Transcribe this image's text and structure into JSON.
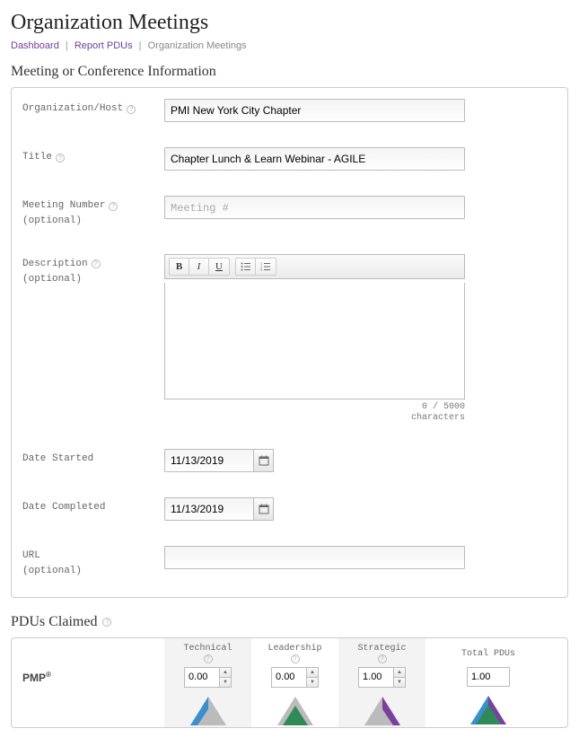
{
  "page_title": "Organization Meetings",
  "breadcrumb": {
    "dashboard": "Dashboard",
    "report_pdus": "Report PDUs",
    "current": "Organization Meetings"
  },
  "section1_title": "Meeting or Conference Information",
  "labels": {
    "org_host": "Organization/Host",
    "title": "Title",
    "meeting_number": "Meeting Number",
    "description": "Description",
    "date_started": "Date Started",
    "date_completed": "Date Completed",
    "url": "URL",
    "optional": "(optional)"
  },
  "fields": {
    "org_host": "PMI New York City Chapter",
    "title": "Chapter Lunch & Learn Webinar - AGILE",
    "meeting_number_value": "",
    "meeting_number_placeholder": "Meeting #",
    "date_started": "11/13/2019",
    "date_completed": "11/13/2019",
    "url": ""
  },
  "rte": {
    "count": "0",
    "max": "5000",
    "sep": " / ",
    "unit": "characters"
  },
  "pdu": {
    "section_title": "PDUs Claimed",
    "row_label": "PMP",
    "row_label_suffix": "®",
    "cols": {
      "technical": {
        "label": "Technical",
        "value": "0.00"
      },
      "leadership": {
        "label": "Leadership",
        "value": "0.00"
      },
      "strategic": {
        "label": "Strategic",
        "value": "1.00"
      },
      "total": {
        "label": "Total PDUs",
        "value": "1.00"
      }
    }
  }
}
